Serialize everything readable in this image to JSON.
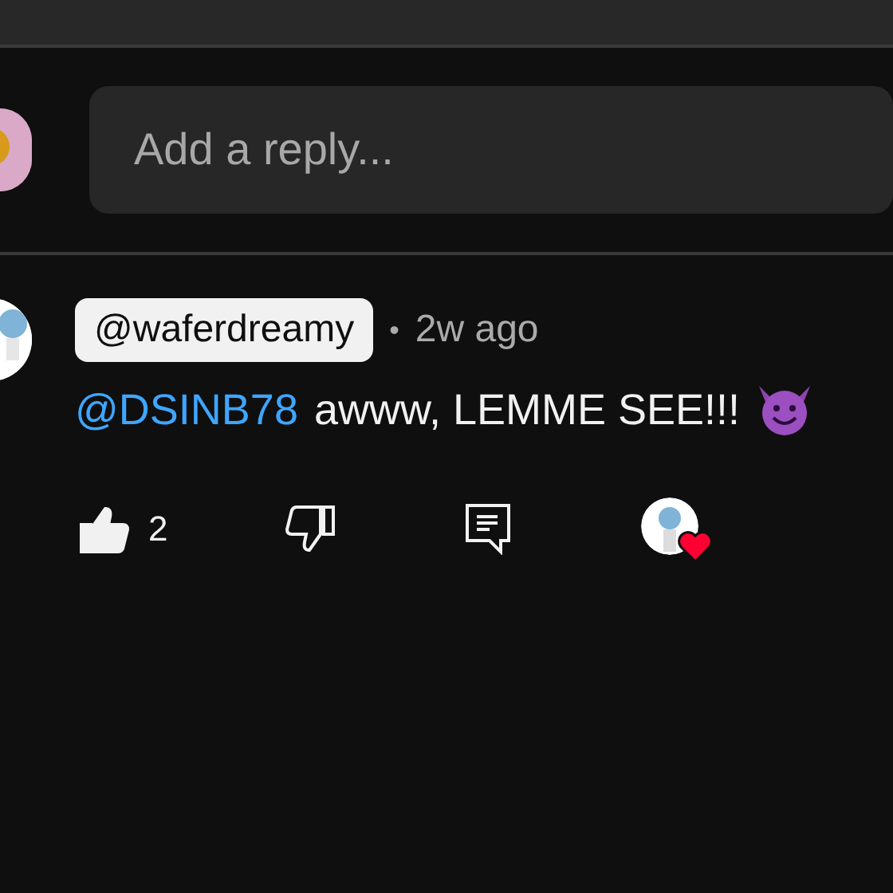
{
  "reply_field": {
    "placeholder": "Add a reply..."
  },
  "comment": {
    "author": "@waferdreamy",
    "highlighted": true,
    "separator": "•",
    "time": "2w ago",
    "mention": "@DSINB78",
    "text": "awww, LEMME SEE!!!",
    "liked": true,
    "like_count": "2",
    "disliked": false,
    "creator_heart": true
  }
}
